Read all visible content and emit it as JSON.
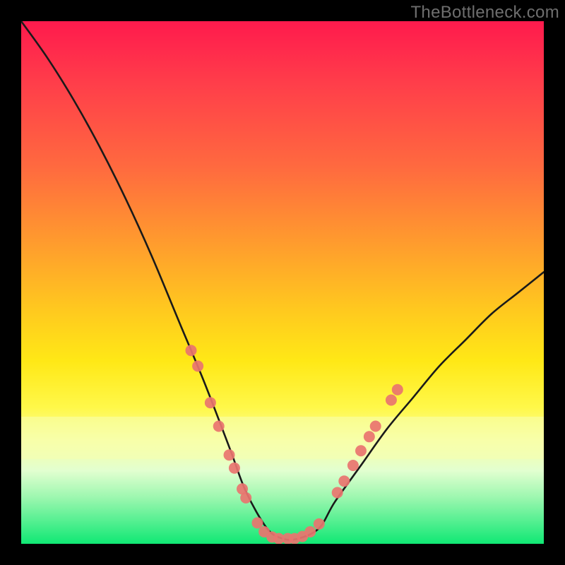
{
  "watermark": "TheBottleneck.com",
  "colors": {
    "frame": "#000000",
    "curve_stroke": "#1a1a1a",
    "dot_fill": "#e9746f",
    "glow_band": "#f6ffb0"
  },
  "chart_data": {
    "type": "line",
    "title": "",
    "xlabel": "",
    "ylabel": "",
    "xlim": [
      0,
      100
    ],
    "ylim": [
      0,
      100
    ],
    "grid": false,
    "legend": false,
    "annotations": [
      "TheBottleneck.com"
    ],
    "series": [
      {
        "name": "bottleneck-curve",
        "x": [
          0,
          5,
          10,
          15,
          20,
          25,
          30,
          35,
          40,
          43,
          47,
          50,
          53,
          57,
          60,
          65,
          70,
          75,
          80,
          85,
          90,
          95,
          100
        ],
        "values": [
          100,
          93,
          85,
          76,
          66,
          55,
          43,
          31,
          18,
          10,
          3,
          1,
          1,
          3,
          8,
          15,
          22,
          28,
          34,
          39,
          44,
          48,
          52
        ]
      }
    ],
    "dots": [
      {
        "x": 32.5,
        "y": 37
      },
      {
        "x": 33.8,
        "y": 34
      },
      {
        "x": 36.2,
        "y": 27
      },
      {
        "x": 37.8,
        "y": 22.5
      },
      {
        "x": 39.8,
        "y": 17
      },
      {
        "x": 40.8,
        "y": 14.5
      },
      {
        "x": 42.3,
        "y": 10.5
      },
      {
        "x": 43.0,
        "y": 8.8
      },
      {
        "x": 45.2,
        "y": 4.0
      },
      {
        "x": 46.5,
        "y": 2.3
      },
      {
        "x": 48.0,
        "y": 1.3
      },
      {
        "x": 49.3,
        "y": 1.0
      },
      {
        "x": 51.0,
        "y": 1.0
      },
      {
        "x": 52.3,
        "y": 1.0
      },
      {
        "x": 53.8,
        "y": 1.4
      },
      {
        "x": 55.3,
        "y": 2.3
      },
      {
        "x": 57.0,
        "y": 3.8
      },
      {
        "x": 61.8,
        "y": 12.0
      },
      {
        "x": 63.5,
        "y": 15.0
      },
      {
        "x": 66.6,
        "y": 20.5
      },
      {
        "x": 60.5,
        "y": 9.8
      },
      {
        "x": 65.0,
        "y": 17.8
      },
      {
        "x": 67.8,
        "y": 22.5
      },
      {
        "x": 70.8,
        "y": 27.5
      },
      {
        "x": 72.0,
        "y": 29.5
      }
    ]
  }
}
